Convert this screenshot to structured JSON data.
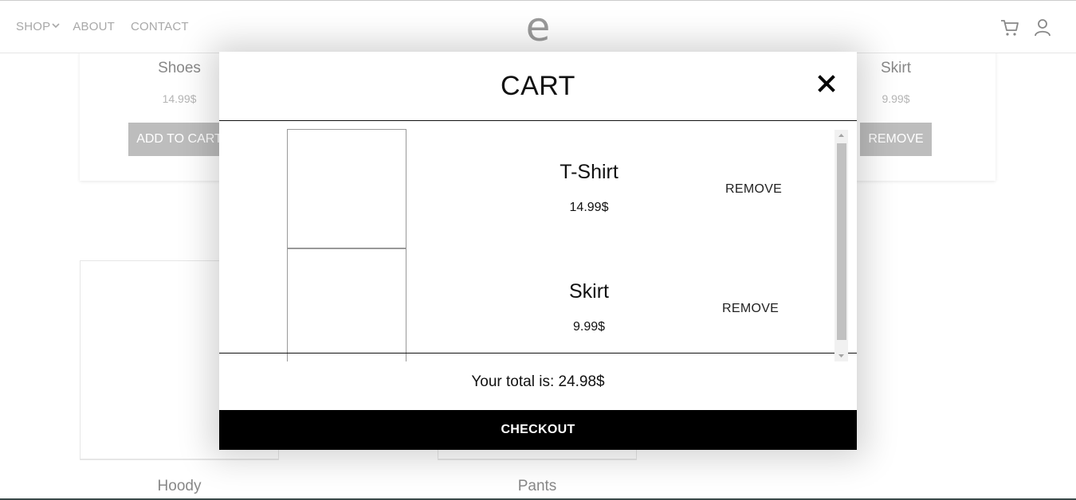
{
  "header": {
    "nav": {
      "shop": "SHOP",
      "about": "ABOUT",
      "contact": "CONTACT"
    },
    "logo": "e",
    "icons": {
      "cart": "cart-icon",
      "user": "user-icon",
      "shop_dropdown": "chevron-down-icon"
    }
  },
  "background_products": {
    "shoes": {
      "name": "Shoes",
      "price": "14.99$",
      "button": "ADD TO CART"
    },
    "skirt": {
      "name": "Skirt",
      "price": "9.99$",
      "button": "REMOVE"
    },
    "hoody": {
      "name": "Hoody"
    },
    "pants": {
      "name": "Pants"
    }
  },
  "modal": {
    "title": "CART",
    "close_icon": "close-icon",
    "items": [
      {
        "name": "T-Shirt",
        "price": "14.99$",
        "remove_label": "REMOVE"
      },
      {
        "name": "Skirt",
        "price": "9.99$",
        "remove_label": "REMOVE"
      }
    ],
    "total_text": "Your total is: 24.98$",
    "checkout_label": "CHECKOUT"
  },
  "colors": {
    "accent": "#000000",
    "nav_text": "#a8a8a8",
    "button_grey": "#bdbdbd"
  }
}
